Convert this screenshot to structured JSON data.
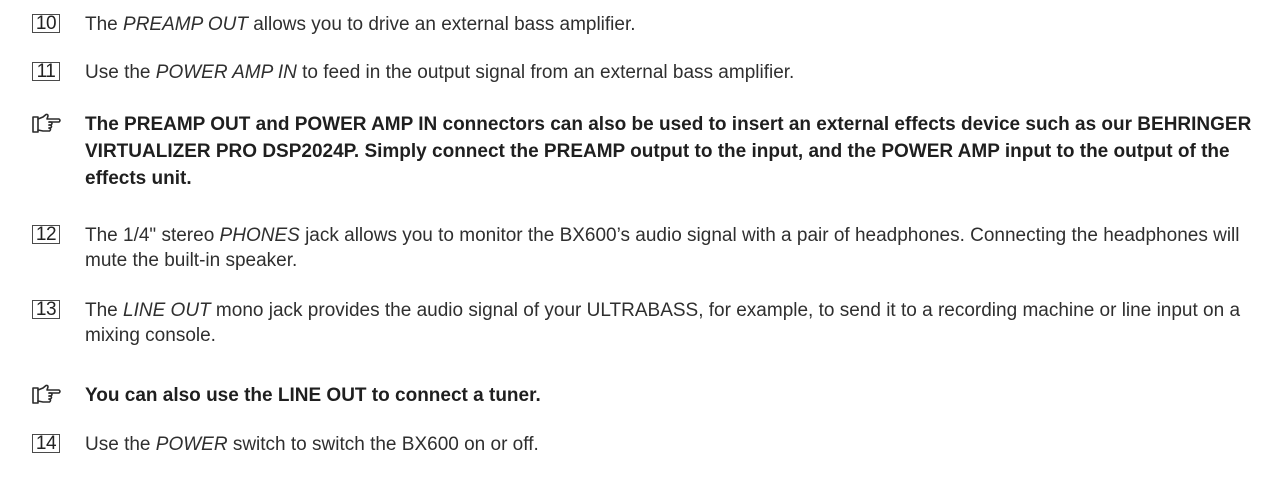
{
  "items": [
    {
      "num": "10",
      "pre": "The ",
      "em": "PREAMP OUT",
      "post": " allows you to drive an external bass amplifier."
    },
    {
      "num": "11",
      "pre": "Use the ",
      "em": "POWER AMP IN",
      "post": " to feed in the output signal from an external bass amplifier."
    },
    {
      "num": "12",
      "pre": "The 1/4\" stereo ",
      "em": "PHONES",
      "post": " jack allows you to monitor the BX600’s audio signal with a pair of headphones. Connecting the headphones will mute the built-in speaker."
    },
    {
      "num": "13",
      "pre": "The ",
      "em": "LINE OUT",
      "post": " mono jack provides the audio signal of your ULTRABASS, for example, to send it to a recording machine or line input on a mixing console."
    },
    {
      "num": "14",
      "pre": "Use the ",
      "em": "POWER",
      "post": " switch to switch the BX600 on or off."
    }
  ],
  "notes": [
    {
      "icon": "pointing-hand-icon",
      "text": "The PREAMP OUT and POWER AMP IN connectors can also be used to insert an external effects device such as our BEHRINGER VIRTUALIZER PRO DSP2024P. Simply connect the PREAMP output to the input, and the POWER AMP input to the output of the effects unit."
    },
    {
      "icon": "pointing-hand-icon",
      "text": "You can also use the LINE OUT to connect a tuner."
    }
  ]
}
